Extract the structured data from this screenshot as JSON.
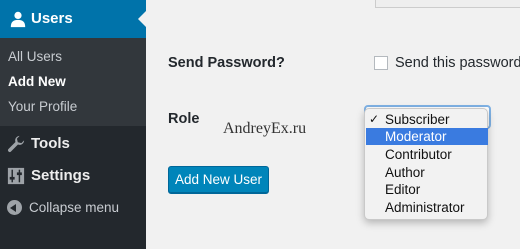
{
  "sidebar": {
    "users": {
      "label": "Users",
      "icon": "user-icon"
    },
    "submenu": [
      {
        "label": "All Users",
        "current": false
      },
      {
        "label": "Add New",
        "current": true
      },
      {
        "label": "Your Profile",
        "current": false
      }
    ],
    "tools": {
      "label": "Tools",
      "icon": "wrench-icon"
    },
    "settings": {
      "label": "Settings",
      "icon": "sliders-icon"
    },
    "collapse": {
      "label": "Collapse menu",
      "icon": "collapse-arrow-icon"
    }
  },
  "form": {
    "send_password_label": "Send Password?",
    "send_password_checkbox_text": "Send this password t",
    "send_password_checked": false,
    "role_label": "Role",
    "role_options": [
      "Subscriber",
      "Moderator",
      "Contributor",
      "Author",
      "Editor",
      "Administrator"
    ],
    "role_selected": "Subscriber",
    "role_highlighted": "Moderator",
    "submit_label": "Add New User"
  },
  "watermark": "AndreyEx.ru",
  "colors": {
    "sidebar_bg": "#23282d",
    "active_menu": "#0073aa",
    "button": "#0085ba",
    "highlight": "#3a7be0"
  }
}
